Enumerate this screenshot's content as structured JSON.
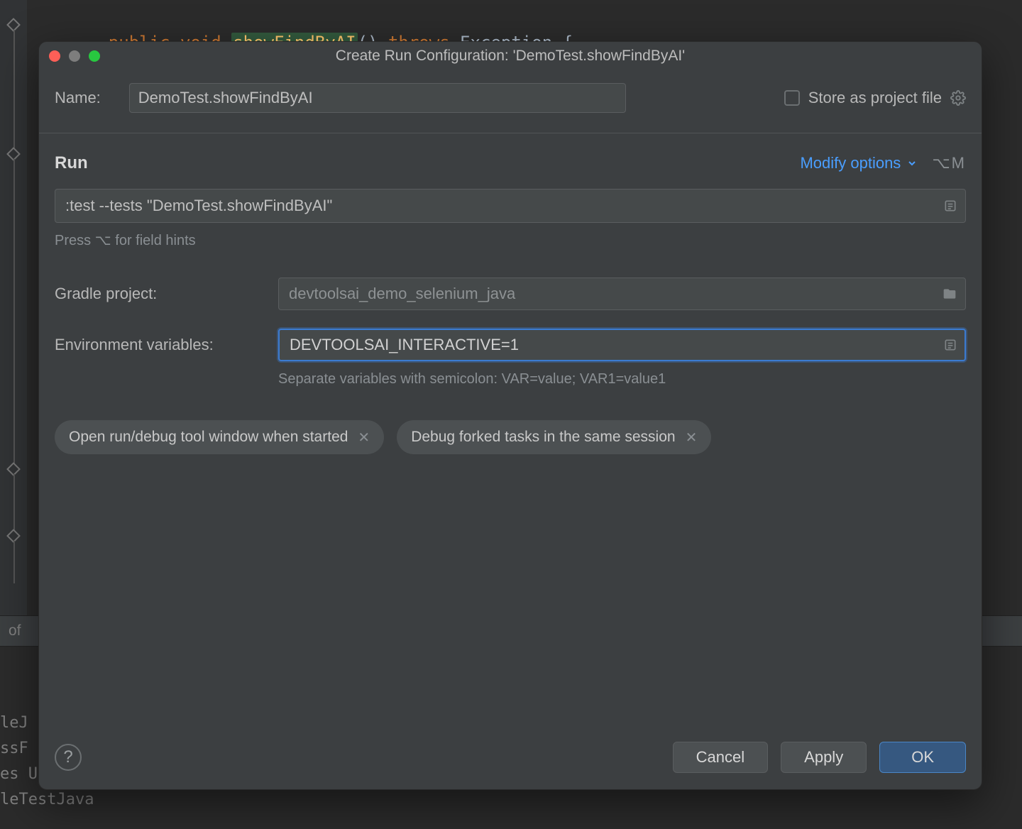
{
  "code": {
    "kw_public": "public",
    "kw_void": "void",
    "method_name": "showFindByAI",
    "parens": "()",
    "kw_throws": "throws",
    "exception": "Exception {"
  },
  "status_bar": {
    "text": "of"
  },
  "console": {
    "line1": "leJ",
    "line2": "ssF",
    "line3": "es UP-TO-DATE",
    "line4": "leTestJava"
  },
  "dialog": {
    "title": "Create Run Configuration: 'DemoTest.showFindByAI'",
    "name_label": "Name:",
    "name_value": "DemoTest.showFindByAI",
    "store_label": "Store as project file",
    "section_run": "Run",
    "modify_label": "Modify options",
    "modify_shortcut": "⌥M",
    "command_value": ":test --tests \"DemoTest.showFindByAI\"",
    "command_hint": "Press ⌥ for field hints",
    "gradle_label": "Gradle project:",
    "gradle_value": "devtoolsai_demo_selenium_java",
    "env_label": "Environment variables:",
    "env_value": "DEVTOOLSAI_INTERACTIVE=1",
    "env_hint": "Separate variables with semicolon: VAR=value; VAR1=value1",
    "chip1": "Open run/debug tool window when started",
    "chip2": "Debug forked tasks in the same session",
    "help": "?",
    "cancel": "Cancel",
    "apply": "Apply",
    "ok": "OK"
  }
}
